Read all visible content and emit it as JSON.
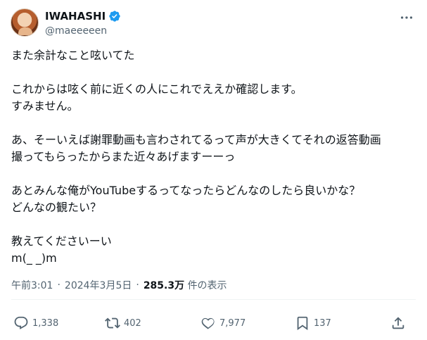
{
  "author": {
    "display_name": "IWAHASHI",
    "handle": "@maeeeeen",
    "verified": true
  },
  "tweet": {
    "lines": [
      "また余計なこと呟いてた",
      "",
      "これからは呟く前に近くの人にこれでええか確認します。",
      "すみません。",
      "",
      "あ、そーいえば謝罪動画も言わされてるって声が大きくてそれの返答動画",
      "撮ってもらったからまた近々あげますーーっ",
      "",
      "あとみんな俺がYouTubeするってなったらどんなのしたら良いかな？",
      "どんなの観たい？",
      "",
      "教えてくださいーい",
      "m(_ _)m"
    ]
  },
  "meta": {
    "time": "午前3:01",
    "separator_1": "·",
    "date": "2024年3月5日",
    "separator_2": "·",
    "views_count": "285.3万",
    "views_label": "件の表示"
  },
  "actions": {
    "reply_count": "1,338",
    "retweet_count": "402",
    "like_count": "7,977",
    "bookmark_count": "137",
    "icons": [
      "reply-icon",
      "retweet-icon",
      "like-icon",
      "bookmark-icon",
      "share-icon"
    ]
  },
  "colors": {
    "text": "#0f1419",
    "secondary": "#536471",
    "verified": "#1d9bf0",
    "divider": "#eff3f4"
  }
}
